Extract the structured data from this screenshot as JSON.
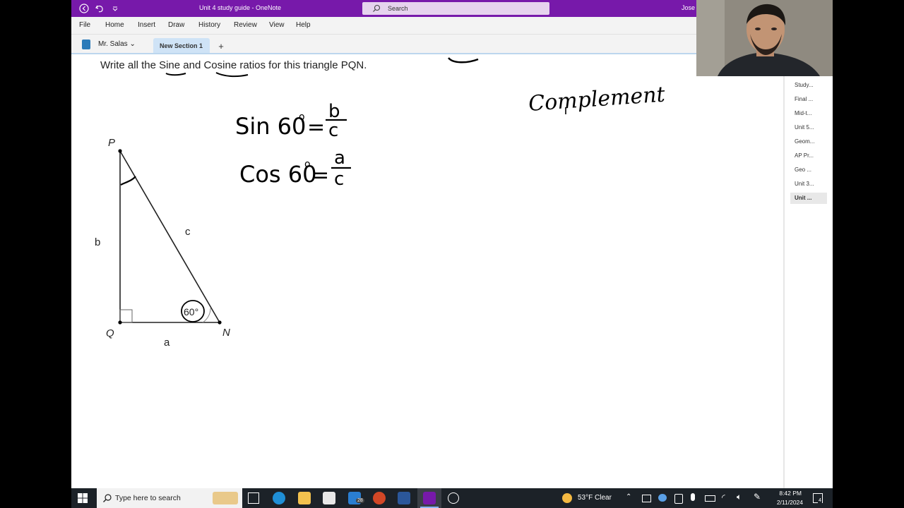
{
  "title_bar": {
    "document_title": "Unit 4 study guide  -  OneNote",
    "search_placeholder": "Search",
    "user_name": "Jose S"
  },
  "menu": [
    "File",
    "Home",
    "Insert",
    "Draw",
    "History",
    "Review",
    "View",
    "Help"
  ],
  "notebook": {
    "name": "Mr. Salas",
    "section_tab": "New Section 1",
    "add_section": "+"
  },
  "page": {
    "instruction": "Write all the Sine and Cosine ratios for this triangle PQN.",
    "triangle": {
      "vertex_p": "P",
      "vertex_q": "Q",
      "vertex_n": "N",
      "side_b": "b",
      "side_c": "c",
      "side_a": "a",
      "angle_label": "60°"
    },
    "handwriting": {
      "complement": "Complement",
      "sin_line": "Sin 60° = b / c",
      "cos_line": "Cos 60° = a / c"
    }
  },
  "page_list": [
    "Study...",
    "Final ...",
    "Mid-t...",
    "Unit 5...",
    "Geom...",
    "AP Pr...",
    "Geo ...",
    "Unit 3...",
    "Unit ..."
  ],
  "taskbar": {
    "search_placeholder": "Type here to search",
    "mail_badge": "28",
    "weather": "53°F  Clear",
    "time": "8:42 PM",
    "date": "2/11/2024",
    "notification_badge": "4"
  },
  "colors": {
    "title_bar": "#7719aa",
    "menu_bar": "#f3f3f3",
    "section_tab": "#cfe3f6",
    "taskbar": "#1c2228"
  }
}
